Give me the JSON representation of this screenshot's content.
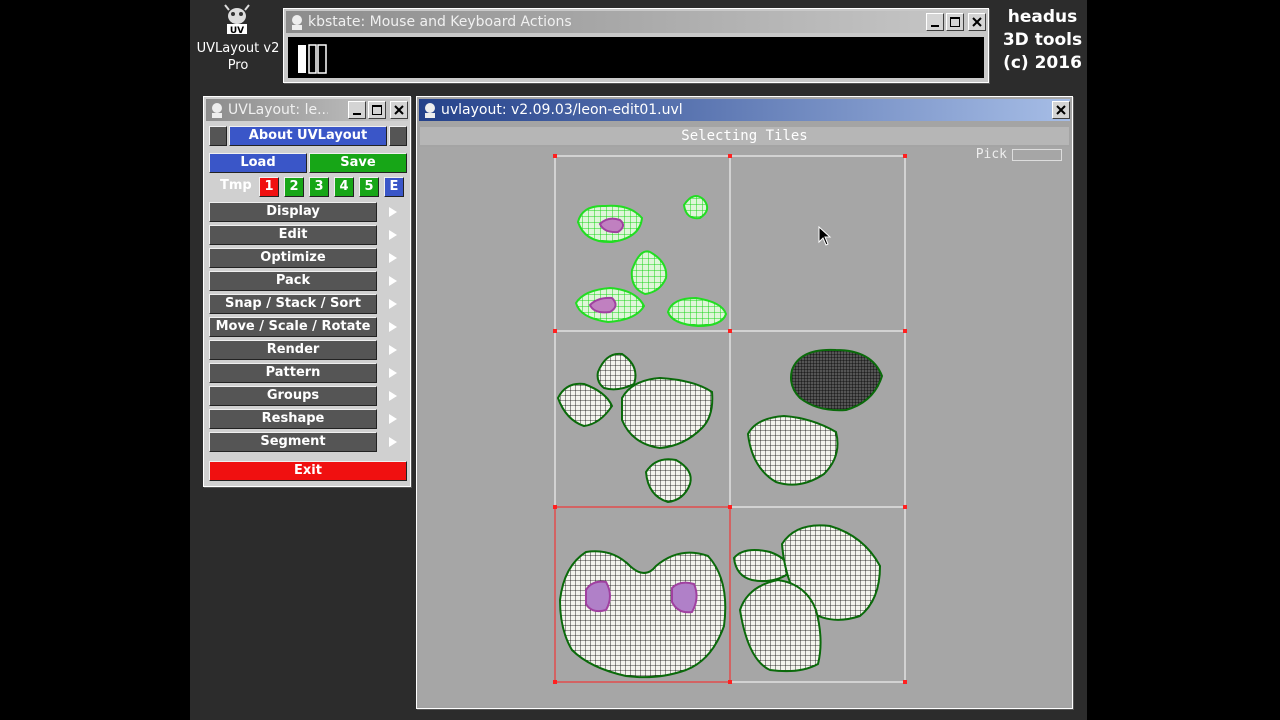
{
  "desktop": {
    "app_label_line1": "UVLayout v2",
    "app_label_line2": "Pro",
    "headus_line1": "headus",
    "headus_line2": "3D tools",
    "headus_line3": "(c) 2016"
  },
  "kbstate_window": {
    "title": "kbstate: Mouse and Keyboard Actions"
  },
  "menu_window": {
    "title": "UVLayout: le...",
    "about_label": "About UVLayout",
    "load_label": "Load",
    "save_label": "Save",
    "tmp_label": "Tmp",
    "tmp_buttons": [
      "1",
      "2",
      "3",
      "4",
      "5",
      "E"
    ],
    "items": [
      "Display",
      "Edit",
      "Optimize",
      "Pack",
      "Snap / Stack / Sort",
      "Move / Scale / Rotate",
      "Render",
      "Pattern",
      "Groups",
      "Reshape",
      "Segment"
    ],
    "exit_label": "Exit"
  },
  "uv_window": {
    "title": "uvlayout: v2.09.03/leon-edit01.uvl",
    "mode_label": "Selecting Tiles",
    "pick_label": "Pick"
  },
  "colors": {
    "selected_shell": "#22dd22",
    "mesh_lines": "#000000",
    "tile_border": "#ffffff",
    "active_tile": "#ff2020"
  }
}
